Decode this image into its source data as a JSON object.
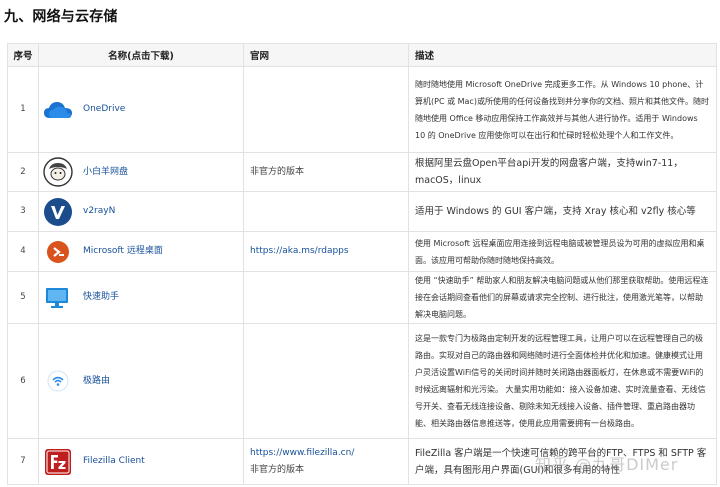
{
  "heading": "九、网络与云存储",
  "headers": {
    "no": "序号",
    "name": "名称(点击下载)",
    "site": "官网",
    "desc": "描述"
  },
  "rows": [
    {
      "no": "1",
      "name": "OneDrive",
      "icon": "onedrive-cloud-icon",
      "site": "",
      "site2": "",
      "desc": "随时随地使用 Microsoft OneDrive 完成更多工作。从 Windows 10 phone、计算机(PC 或 Mac)或所使用的任何设备找到并分享你的文档、照片和其他文件。随时随地使用 Office 移动应用保持工作高效并与其他人进行协作。适用于 Windows 10 的 OneDrive 应用使你可以在出行和忙碌时轻松处理个人和工作文件。"
    },
    {
      "no": "2",
      "name": "小白羊网盘",
      "icon": "sheep-icon",
      "site": "非官方的版本",
      "site2": "",
      "desc": "根据阿里云盘Open平台api开发的网盘客户端，支持win7-11，macOS，linux"
    },
    {
      "no": "3",
      "name": "v2rayN",
      "icon": "v2rayn-v-icon",
      "site": "",
      "site2": "",
      "desc": "适用于 Windows 的 GUI 客户端，支持 Xray 核心和 v2fly 核心等"
    },
    {
      "no": "4",
      "name": "Microsoft 远程桌面",
      "icon": "remote-desktop-icon",
      "site": "https://aka.ms/rdapps",
      "site2": "",
      "desc": "使用 Microsoft 远程桌面应用连接到远程电脑或被管理员设为可用的虚拟应用和桌面。该应用可帮助你随时随地保持高效。"
    },
    {
      "no": "5",
      "name": "快速助手",
      "icon": "monitor-icon",
      "site": "",
      "site2": "",
      "desc": "使用 “快速助手” 帮助家人和朋友解决电脑问题或从他们那里获取帮助。使用远程连接在会话期间查看他们的屏幕或请求完全控制、进行批注，使用激光笔等，以帮助解决电脑问题。"
    },
    {
      "no": "6",
      "name": "极路由",
      "icon": "router-wifi-icon",
      "site": "",
      "site2": "",
      "desc": "这是一款专门为极路由定制开发的远程管理工具，让用户可以在远程管理自己的极路由。实现对自己的路由器和网络随时进行全面体检并优化和加速。健康模式让用户灵活设置WiFi信号的关闭时间并随时关闭路由器面板灯，在休息或不需要WiFi的时候远离辐射和光污染。 大量实用功能如：接入设备加速、实时流量查看、无线信号开关、查看无线连接设备、剔除未知无线接入设备、插件管理、重启路由器功能、相关路由器信息推送等，使用此应用需要拥有一台极路由。"
    },
    {
      "no": "7",
      "name": "Filezilla Client",
      "icon": "filezilla-icon",
      "site": "https://www.filezilla.cn/",
      "site2": "非官方的版本",
      "desc": "FileZilla 客户端是一个快速可信赖的跨平台的FTP、FTPS 和 SFTP 客户端，具有图形用户界面(GUI)和很多有用的特性"
    }
  ],
  "watermark": "知乎 @九哥DIMer",
  "colors": {
    "link": "#175199",
    "border": "#e2e2e2",
    "header_bg": "#f6f6f6"
  }
}
